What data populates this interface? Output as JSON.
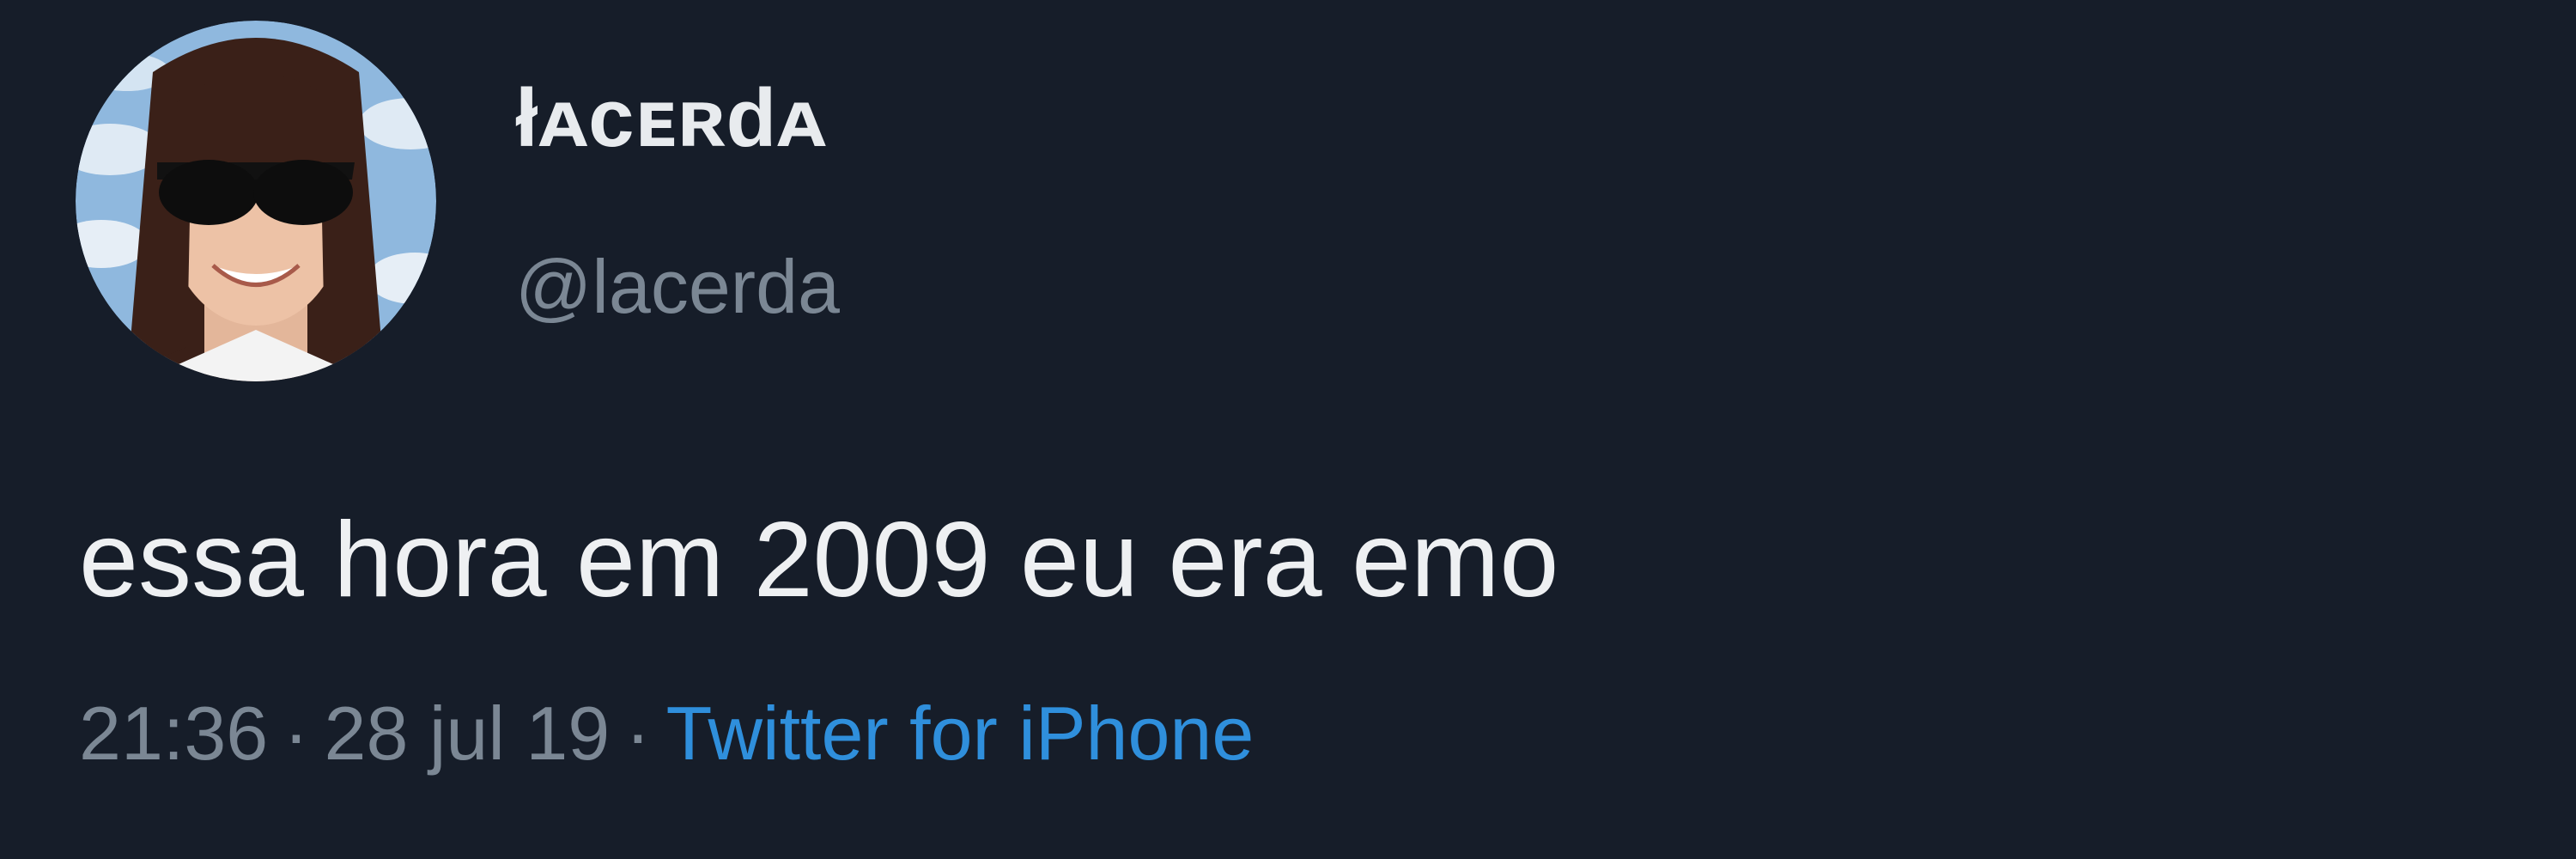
{
  "tweet": {
    "author": {
      "display_name": "łᴀᴄᴇʀdᴀ",
      "handle": "@lacerda"
    },
    "text": "essa hora em 2009 eu era emo",
    "time": "21:36",
    "date": "28 jul 19",
    "separator": "·",
    "source": "Twitter for iPhone"
  },
  "colors": {
    "background": "#161d29",
    "text": "#eef0f2",
    "muted": "#7b8794",
    "link": "#2f8fdc"
  }
}
